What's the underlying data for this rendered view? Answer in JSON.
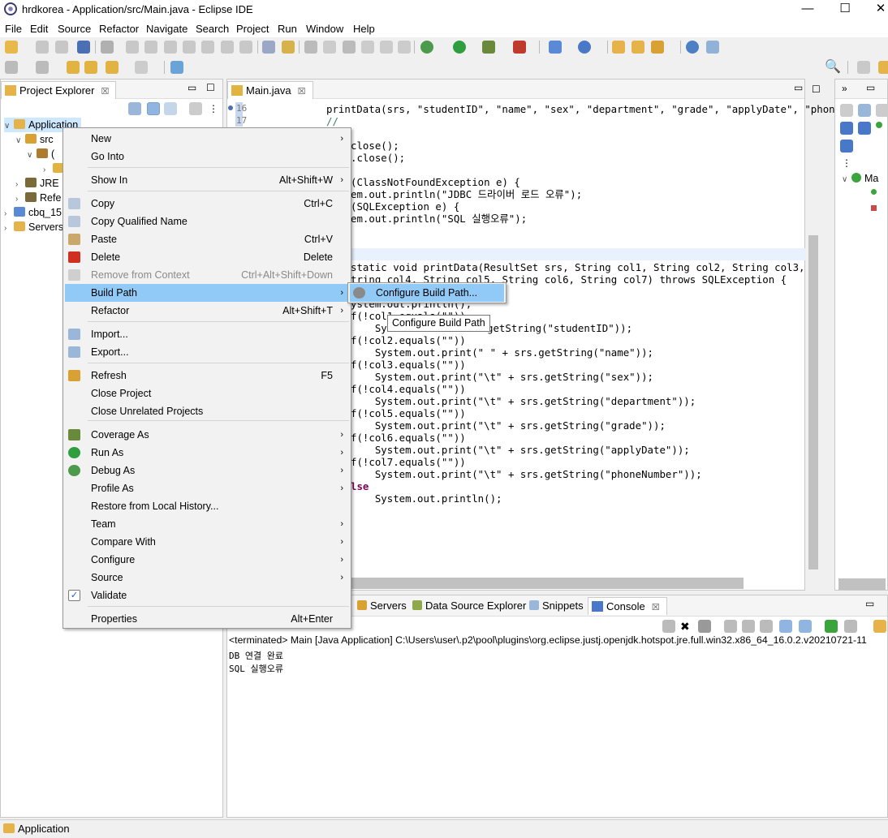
{
  "window": {
    "title": "hrdkorea - Application/src/Main.java - Eclipse IDE",
    "minimize": "—",
    "maximize": "☐",
    "close": "✕"
  },
  "menubar": [
    "File",
    "Edit",
    "Source",
    "Refactor",
    "Navigate",
    "Search",
    "Project",
    "Run",
    "Window",
    "Help"
  ],
  "project_explorer": {
    "tab_label": "Project Explorer",
    "tab_close": "☒",
    "tree": [
      "Application",
      "src",
      "(",
      "JRE",
      "Refe",
      "cbq_15",
      "Servers"
    ]
  },
  "editor": {
    "tab_label": "Main.java",
    "tab_close": "☒",
    "line_numbers": [
      "16",
      "17"
    ],
    "code_lines": [
      {
        "text": "printData(srs, \"studentID\", \"name\", \"sex\", \"department\", \"grade\", \"applyDate\", \"phon"
      },
      {
        "text": "//"
      },
      {
        "text": "close();"
      },
      {
        "text": ".close();"
      },
      {
        "text": "(ClassNotFoundException e) {"
      },
      {
        "text": "em.out.println(\"JDBC 드라이버 로드 오류\");"
      },
      {
        "text": "(SQLException e) {"
      },
      {
        "text": "em.out.println(\"SQL 실행오류\");"
      },
      {
        "text": "static void printData(ResultSet srs, String col1, String col2, String col3,"
      },
      {
        "text": "tring col4, String col5, String col6, String col7) throws SQLException {"
      },
      {
        "text": "f(!col2.equals(\"\"))"
      },
      {
        "text": "    System.out.print(\" \" + srs.getString(\"name\"));"
      },
      {
        "text": "f(!col3.equals(\"\"))"
      },
      {
        "text": "    System.out.print(\"\\t\" + srs.getString(\"sex\"));"
      },
      {
        "text": "f(!col4.equals(\"\"))"
      },
      {
        "text": "    System.out.print(\"\\t\" + srs.getString(\"department\"));"
      },
      {
        "text": "f(!col5.equals(\"\"))"
      },
      {
        "text": "    System.out.print(\"\\t\" + srs.getString(\"grade\"));"
      },
      {
        "text": "f(!col6.equals(\"\"))"
      },
      {
        "text": "    System.out.print(\"\\t\" + srs.getString(\"applyDate\"));"
      },
      {
        "text": "f(!col7.equals(\"\"))"
      },
      {
        "text": "    System.out.print(\"\\t\" + srs.getString(\"phoneNumber\"));"
      },
      {
        "text": "lse"
      },
      {
        "text": "    System.out.println();"
      }
    ],
    "partial_lines": {
      "line_a": "ystem.out.println();",
      "line_b": "f(!col1.equals(\"\"))",
      "line_c": "    Sys",
      "line_d": "getString(\"studentID\"));"
    }
  },
  "bottom_tabs": [
    "Servers",
    "Data Source Explorer",
    "Snippets",
    "Console"
  ],
  "console": {
    "close": "☒",
    "header": "<terminated> Main [Java Application] C:\\Users\\user\\.p2\\pool\\plugins\\org.eclipse.justj.openjdk.hotspot.jre.full.win32.x86_64_16.0.2.v20210721-11",
    "lines": [
      "DB 연결 완료",
      "SQL 실행오류"
    ]
  },
  "right_panel": {
    "label": "Ma"
  },
  "status": {
    "text": "Application"
  },
  "context_menu": {
    "items": [
      {
        "label": "New",
        "shortcut": "",
        "submenu": true
      },
      {
        "label": "Go Into",
        "shortcut": ""
      },
      {
        "label": "Show In",
        "shortcut": "Alt+Shift+W",
        "submenu": true
      },
      {
        "label": "Copy",
        "shortcut": "Ctrl+C"
      },
      {
        "label": "Copy Qualified Name",
        "shortcut": ""
      },
      {
        "label": "Paste",
        "shortcut": "Ctrl+V"
      },
      {
        "label": "Delete",
        "shortcut": "Delete"
      },
      {
        "label": "Remove from Context",
        "shortcut": "Ctrl+Alt+Shift+Down",
        "disabled": true
      },
      {
        "label": "Build Path",
        "shortcut": "",
        "submenu": true,
        "highlighted": true
      },
      {
        "label": "Refactor",
        "shortcut": "Alt+Shift+T",
        "submenu": true
      },
      {
        "label": "Import...",
        "shortcut": ""
      },
      {
        "label": "Export...",
        "shortcut": ""
      },
      {
        "label": "Refresh",
        "shortcut": "F5"
      },
      {
        "label": "Close Project",
        "shortcut": ""
      },
      {
        "label": "Close Unrelated Projects",
        "shortcut": ""
      },
      {
        "label": "Coverage As",
        "shortcut": "",
        "submenu": true
      },
      {
        "label": "Run As",
        "shortcut": "",
        "submenu": true
      },
      {
        "label": "Debug As",
        "shortcut": "",
        "submenu": true
      },
      {
        "label": "Profile As",
        "shortcut": "",
        "submenu": true
      },
      {
        "label": "Restore from Local History...",
        "shortcut": ""
      },
      {
        "label": "Team",
        "shortcut": "",
        "submenu": true
      },
      {
        "label": "Compare With",
        "shortcut": "",
        "submenu": true
      },
      {
        "label": "Configure",
        "shortcut": "",
        "submenu": true
      },
      {
        "label": "Source",
        "shortcut": "",
        "submenu": true
      },
      {
        "label": "Validate",
        "shortcut": ""
      },
      {
        "label": "Properties",
        "shortcut": "Alt+Enter"
      }
    ],
    "submenu_arrow": "›"
  },
  "submenu": {
    "item": "Configure Build Path..."
  },
  "tooltip": {
    "text": "Configure Build Path"
  },
  "colors": {
    "highlight": "#91c9f7",
    "keyword": "#7f0055",
    "string": "#2a00ff",
    "field": "#0000c0"
  }
}
